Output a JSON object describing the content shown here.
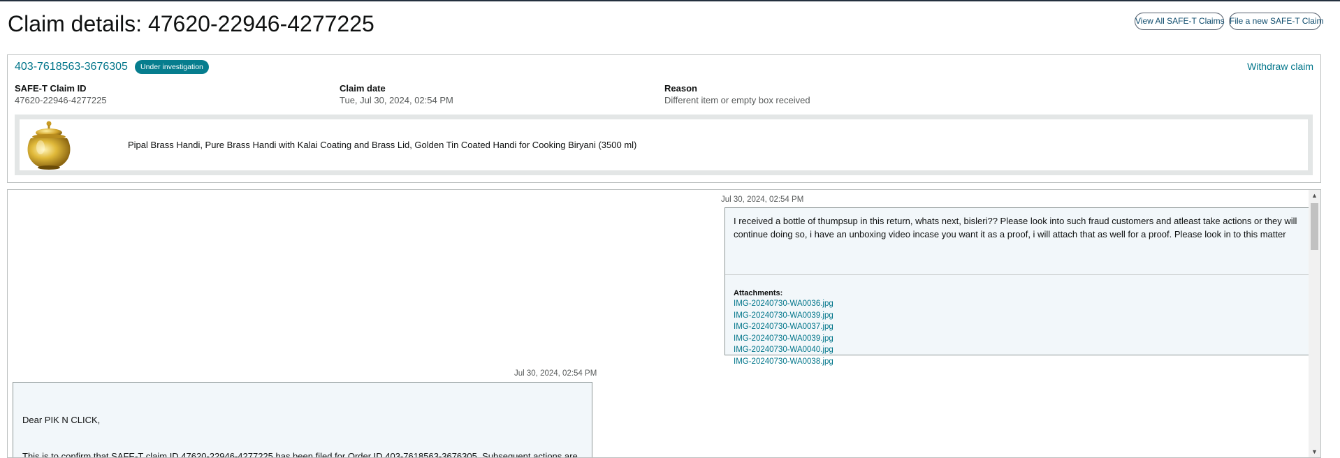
{
  "page": {
    "title": "Claim details: 47620-22946-4277225"
  },
  "header_buttons": {
    "view_all": "View All SAFE-T Claims",
    "file_new": "File a new SAFE-T Claim"
  },
  "claim": {
    "order_id": "403-7618563-3676305",
    "status": "Under investigation",
    "withdraw": "Withdraw claim",
    "fields": {
      "claim_id_label": "SAFE-T Claim ID",
      "claim_id_value": "47620-22946-4277225",
      "date_label": "Claim date",
      "date_value": "Tue, Jul 30, 2024, 02:54 PM",
      "reason_label": "Reason",
      "reason_value": "Different item or empty box received"
    },
    "product": {
      "name": "Pipal Brass Handi, Pure Brass Handi with Kalai Coating and Brass Lid, Golden Tin Coated Handi for Cooking Biryani (3500 ml)"
    }
  },
  "messages": [
    {
      "time": "Jul 30, 2024, 02:54 PM",
      "text": "I received a bottle of thumpsup in this return, whats next, bisleri?? Please look into such fraud customers and atleast take actions or they will continue doing so, i have an unboxing video incase you want it as a proof, i will attach that as well for a proof. Please look in to this matter",
      "attachments_label": "Attachments:",
      "attachments": [
        "IMG-20240730-WA0036.jpg",
        "IMG-20240730-WA0039.jpg",
        "IMG-20240730-WA0037.jpg",
        "IMG-20240730-WA0039.jpg",
        "IMG-20240730-WA0040.jpg",
        "IMG-20240730-WA0038.jpg"
      ]
    },
    {
      "time": "Jul 30, 2024, 02:54 PM",
      "greeting": "Dear PIK N CLICK,",
      "body": "This is to confirm that SAFE-T claim ID 47620-22946-4277225 has been filed for Order ID 403-7618563-3676305. Subsequent actions are"
    }
  ],
  "icons": {
    "scroll_up": "▲",
    "scroll_down": "▼"
  },
  "colors": {
    "accent": "#00758a",
    "badge": "#067d8e",
    "message_bg": "#f2f7fa"
  }
}
